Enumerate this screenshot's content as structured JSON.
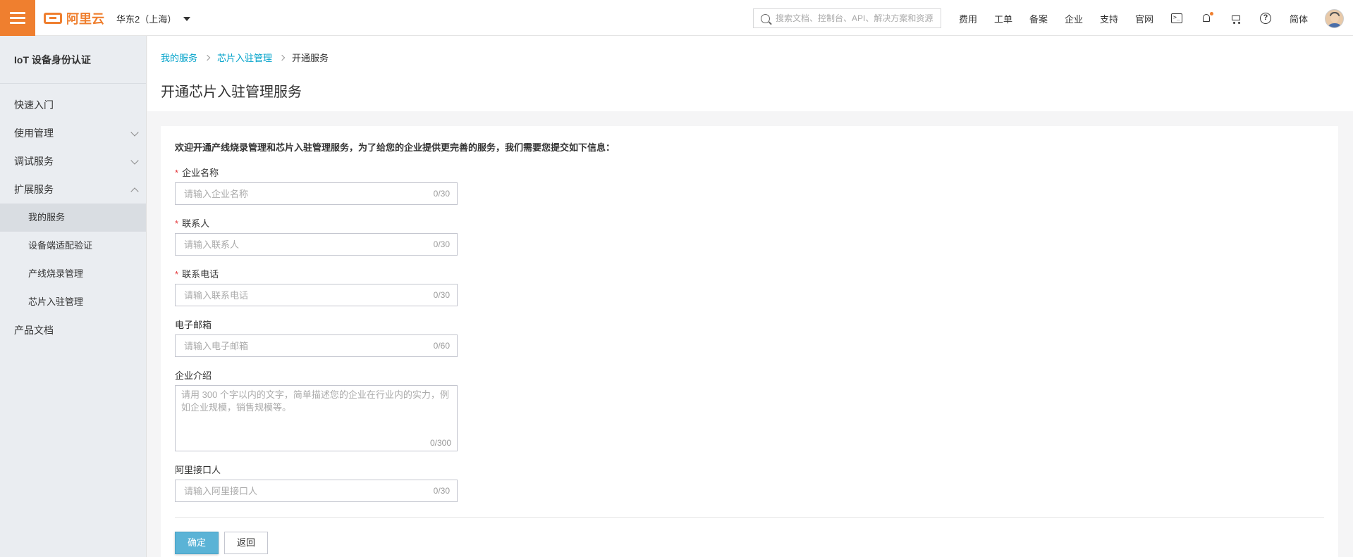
{
  "topbar": {
    "region": "华东2（上海）",
    "search_placeholder": "搜索文档、控制台、API、解决方案和资源",
    "links": {
      "fees": "费用",
      "tickets": "工单",
      "icp": "备案",
      "enterprise": "企业",
      "support": "支持",
      "official": "官网",
      "language": "简体"
    },
    "brand_color": "#ef7f2f",
    "logo_text": "阿里云"
  },
  "sidebar": {
    "title": "IoT 设备身份认证",
    "items": [
      {
        "label": "快速入门"
      },
      {
        "label": "使用管理"
      },
      {
        "label": "调试服务"
      },
      {
        "label": "扩展服务"
      },
      {
        "label": "我的服务"
      },
      {
        "label": "设备端适配验证"
      },
      {
        "label": "产线烧录管理"
      },
      {
        "label": "芯片入驻管理"
      },
      {
        "label": "产品文档"
      }
    ]
  },
  "breadcrumb": {
    "items": [
      "我的服务",
      "芯片入驻管理",
      "开通服务"
    ]
  },
  "page": {
    "title": "开通芯片入驻管理服务",
    "intro": "欢迎开通产线烧录管理和芯片入驻管理服务，为了给您的企业提供更完善的服务，我们需要您提交如下信息："
  },
  "form": {
    "company": {
      "label": "企业名称",
      "placeholder": "请输入企业名称",
      "count": "0/30",
      "required": true
    },
    "contact": {
      "label": "联系人",
      "placeholder": "请输入联系人",
      "count": "0/30",
      "required": true
    },
    "phone": {
      "label": "联系电话",
      "placeholder": "请输入联系电话",
      "count": "0/30",
      "required": true
    },
    "email": {
      "label": "电子邮箱",
      "placeholder": "请输入电子邮箱",
      "count": "0/60",
      "required": false
    },
    "intro": {
      "label": "企业介绍",
      "placeholder": "请用 300 个字以内的文字，简单描述您的企业在行业内的实力，例如企业规模，销售规模等。",
      "count": "0/300",
      "required": false
    },
    "ali_contact": {
      "label": "阿里接口人",
      "placeholder": "请输入阿里接口人",
      "count": "0/30",
      "required": false
    },
    "required_mark": "*",
    "submit_label": "确定",
    "back_label": "返回"
  }
}
